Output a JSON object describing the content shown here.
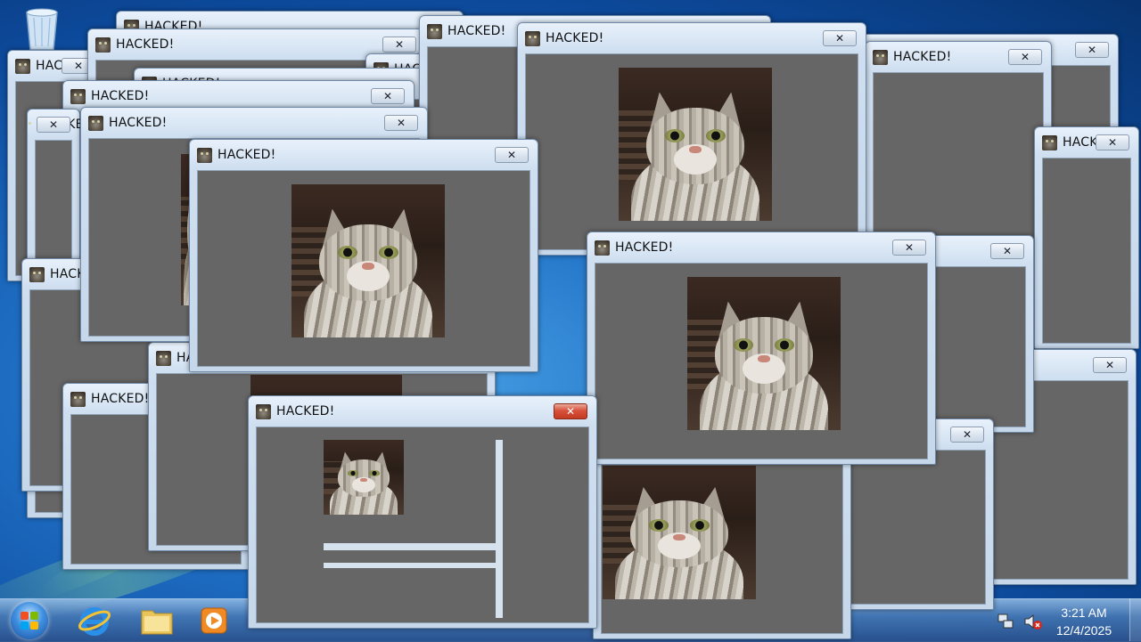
{
  "desktop": {
    "recycle_bin_icon": "recycle-bin-icon"
  },
  "window": {
    "title": "HACKED!",
    "icon": "cat-icon",
    "close_glyph": "✕",
    "image": "cat-photo"
  },
  "taskbar": {
    "start_icon": "windows-start-icon",
    "pinned": [
      {
        "name": "internet-explorer-icon"
      },
      {
        "name": "file-explorer-icon"
      },
      {
        "name": "media-player-icon"
      }
    ],
    "tray_icons": [
      "network-icon",
      "volume-muted-icon"
    ],
    "clock": {
      "time": "3:21 AM",
      "date": "12/4/2025"
    }
  },
  "colors": {
    "client_bg": "#666666",
    "close_active": "#c43a22",
    "desktop_blue": "#1f6fc5"
  }
}
